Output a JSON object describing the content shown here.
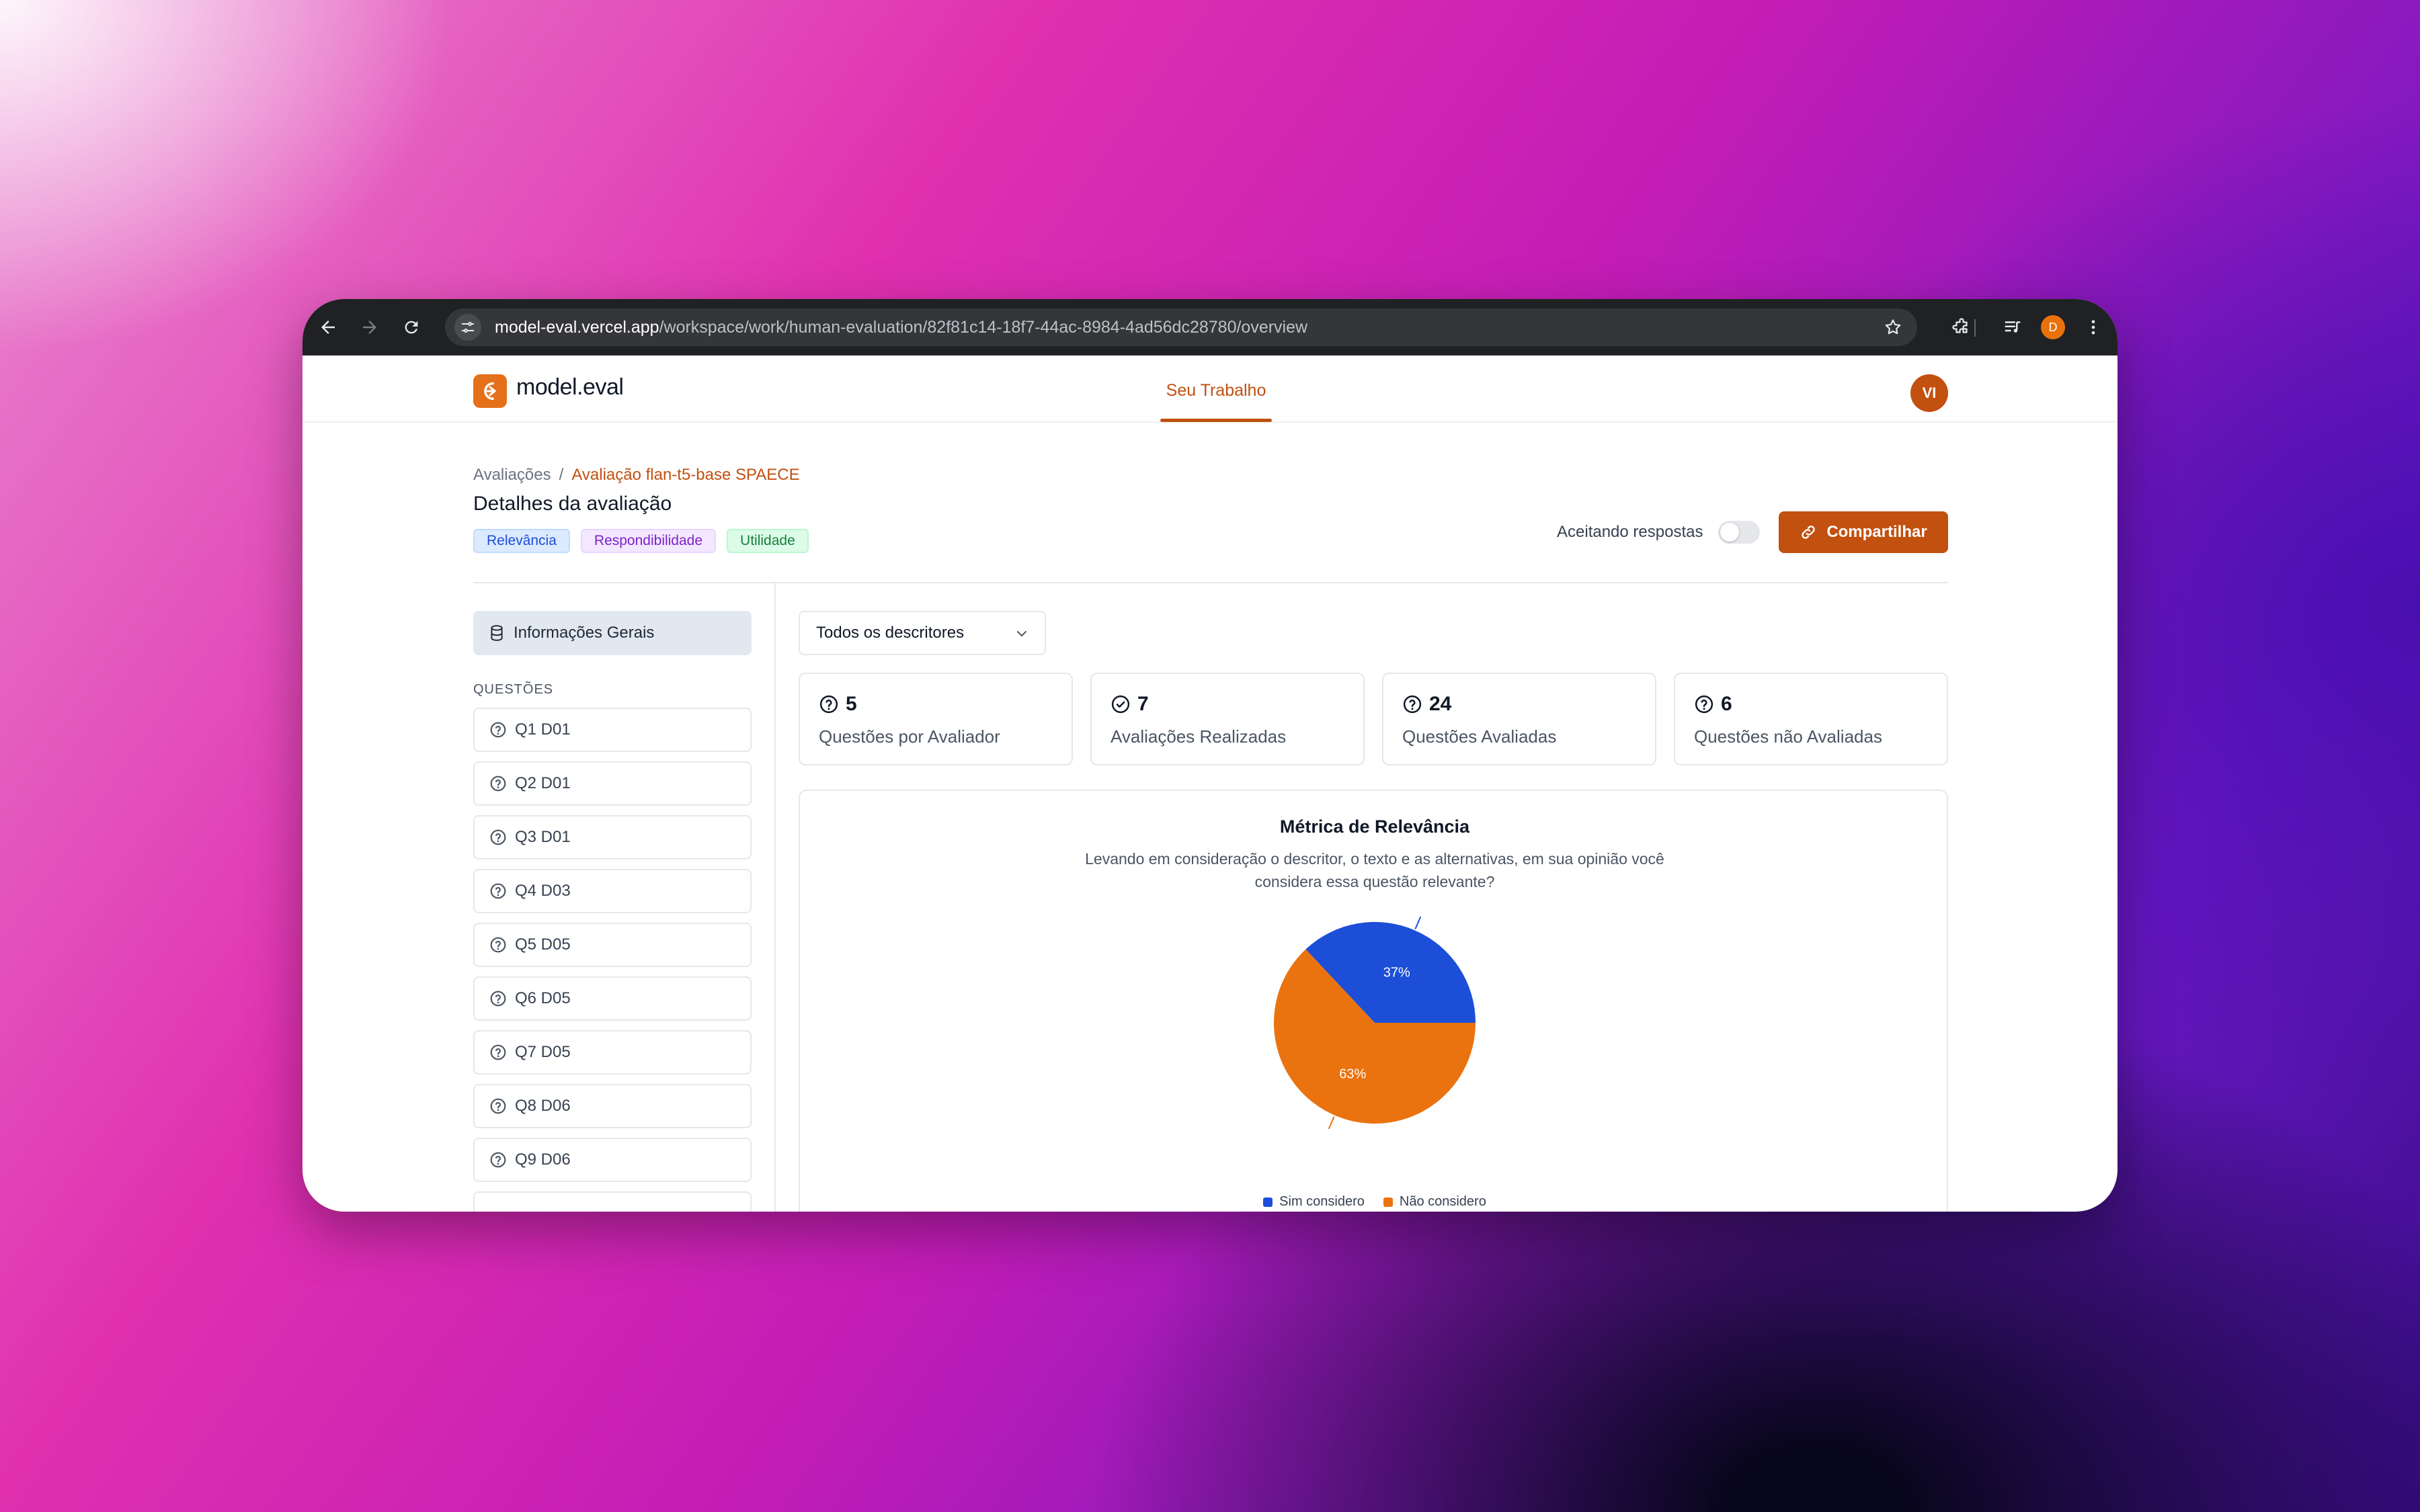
{
  "browser": {
    "url_domain": "model-eval.vercel.app",
    "url_path": "/workspace/work/human-evaluation/82f81c14-18f7-44ac-8984-4ad56dc28780/overview",
    "profile_initial": "D"
  },
  "header": {
    "brand": "model.eval",
    "nav_tab": "Seu Trabalho",
    "avatar_initials": "VI"
  },
  "page": {
    "breadcrumb_root": "Avaliações",
    "breadcrumb_separator": "/",
    "breadcrumb_current": "Avaliação flan-t5-base SPAECE",
    "title": "Detalhes da avaliação",
    "tags": [
      "Relevância",
      "Respondibilidade",
      "Utilidade"
    ],
    "accepting_label": "Aceitando respostas",
    "accepting_enabled": false,
    "share_label": "Compartilhar"
  },
  "sidebar": {
    "active_item": "Informações Gerais",
    "section_heading": "QUESTÕES",
    "questions": [
      "Q1 D01",
      "Q2 D01",
      "Q3 D01",
      "Q4 D03",
      "Q5 D05",
      "Q6 D05",
      "Q7 D05",
      "Q8 D06",
      "Q9 D06"
    ]
  },
  "filter": {
    "selected": "Todos os descritores"
  },
  "stats": [
    {
      "value": "5",
      "label": "Questões por Avaliador",
      "icon": "question-circle-icon"
    },
    {
      "value": "7",
      "label": "Avaliações Realizadas",
      "icon": "check-circle-icon"
    },
    {
      "value": "24",
      "label": "Questões Avaliadas",
      "icon": "question-circle-icon"
    },
    {
      "value": "6",
      "label": "Questões não Avaliadas",
      "icon": "question-circle-icon"
    }
  ],
  "chart_data": {
    "type": "pie",
    "title": "Métrica de Relevância",
    "subtitle": "Levando em consideração o descritor, o texto e as alternativas, em sua opinião você considera essa questão relevante?",
    "categories": [
      "Sim considero",
      "Não considero"
    ],
    "values": [
      37,
      63
    ],
    "labels": [
      "37%",
      "63%"
    ],
    "colors": [
      "#1d4ed8",
      "#ea730f"
    ],
    "legend_position": "bottom"
  },
  "colors": {
    "accent": "#c2500f",
    "brand_logo": "#e5701a"
  }
}
